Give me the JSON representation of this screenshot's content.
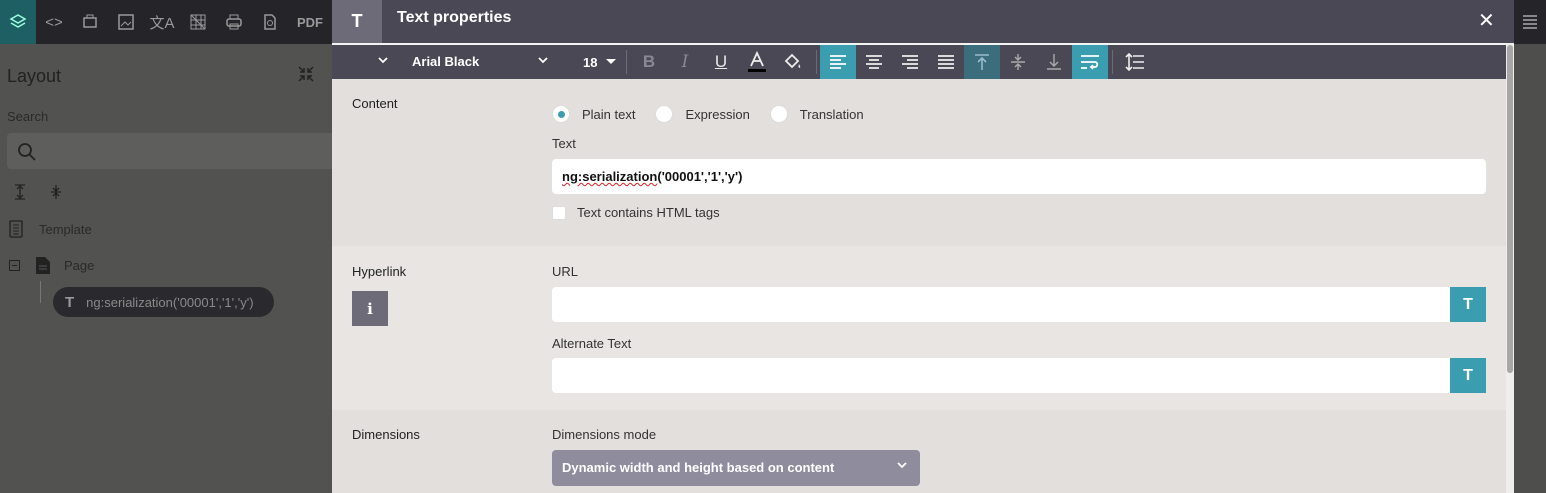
{
  "background": {
    "toolbar": {
      "items": [
        "layers-icon",
        "code-icon",
        "plugin-icon",
        "image-icon",
        "translate-icon",
        "grid-icon",
        "print-icon",
        "preview-icon"
      ],
      "pdf_label": "PDF"
    },
    "layout_title": "Layout",
    "search_label": "Search",
    "tree": {
      "template_label": "Template",
      "page_label": "Page",
      "selected_node_label": "ng:serialization('00001','1','y')",
      "selected_node_type": "T"
    }
  },
  "dialog": {
    "type_badge": "T",
    "title": "Text properties",
    "close_symbol": "✕",
    "format_bar": {
      "font_name": "Arial Black",
      "font_size": "18"
    },
    "content": {
      "section_label": "Content",
      "radio_options": [
        {
          "label": "Plain text",
          "checked": true
        },
        {
          "label": "Expression",
          "checked": false
        },
        {
          "label": "Translation",
          "checked": false
        }
      ],
      "text_label": "Text",
      "text_value_prefix": "ng:serialization",
      "text_value_suffix": "('00001','1','y')",
      "html_tags_label": "Text contains HTML tags"
    },
    "hyperlink": {
      "section_label": "Hyperlink",
      "info_symbol": "i",
      "url_label": "URL",
      "url_value": "",
      "alt_label": "Alternate Text",
      "alt_value": "",
      "t_button": "T"
    },
    "dimensions": {
      "section_label": "Dimensions",
      "mode_label": "Dimensions mode",
      "mode_value": "Dynamic width and height based on content"
    }
  },
  "colors": {
    "accent": "#3a9db0",
    "header": "#4a4854"
  }
}
